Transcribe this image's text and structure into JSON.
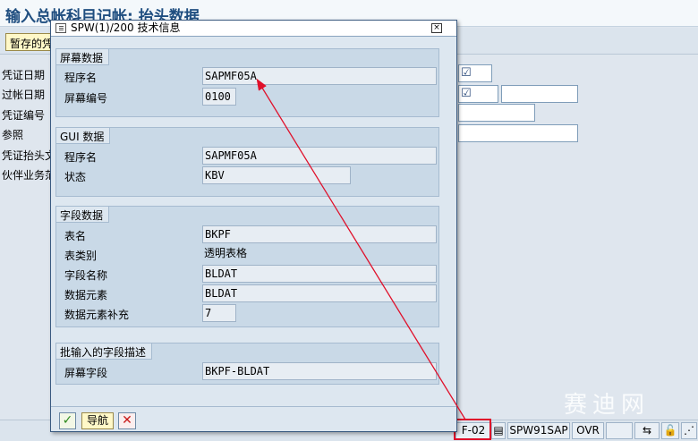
{
  "background": {
    "title": "输入总帐科目记帐: 抬头数据",
    "toolbar_button": "暂存的凭",
    "labels": [
      "凭证日期",
      "过帐日期",
      "凭证编号",
      "参照",
      "凭证抬头文",
      "伙伴业务范"
    ]
  },
  "dialog": {
    "title": "SPW(1)/200 技术信息",
    "close_glyph": "×",
    "screen_group": {
      "header": "屏幕数据",
      "program_label": "程序名",
      "program_value": "SAPMF05A",
      "screen_no_label": "屏幕编号",
      "screen_no_value": "0100"
    },
    "gui_group": {
      "header": "GUI 数据",
      "program_label": "程序名",
      "program_value": "SAPMF05A",
      "status_label": "状态",
      "status_value": "KBV"
    },
    "field_group": {
      "header": "字段数据",
      "table_label": "表名",
      "table_value": "BKPF",
      "table_cat_label": "表类别",
      "table_cat_value": "透明表格",
      "field_label": "字段名称",
      "field_value": "BLDAT",
      "dataelem_label": "数据元素",
      "dataelem_value": "BLDAT",
      "supp_label": "数据元素补充",
      "supp_value": "7"
    },
    "batch_group": {
      "header": "批输入的字段描述",
      "screen_field_label": "屏幕字段",
      "screen_field_value": "BKPF-BLDAT"
    },
    "footer": {
      "ok_glyph": "✓",
      "nav_label": "导航",
      "cancel_glyph": "✕"
    }
  },
  "statusbar": {
    "tcode": "F-02",
    "system": "SPW91SAP",
    "mode": "OVR"
  },
  "watermark": "赛迪网",
  "colors": {
    "highlight": "#e0102a",
    "arrow": "#e0102a",
    "title_blue": "#1f4e80"
  }
}
